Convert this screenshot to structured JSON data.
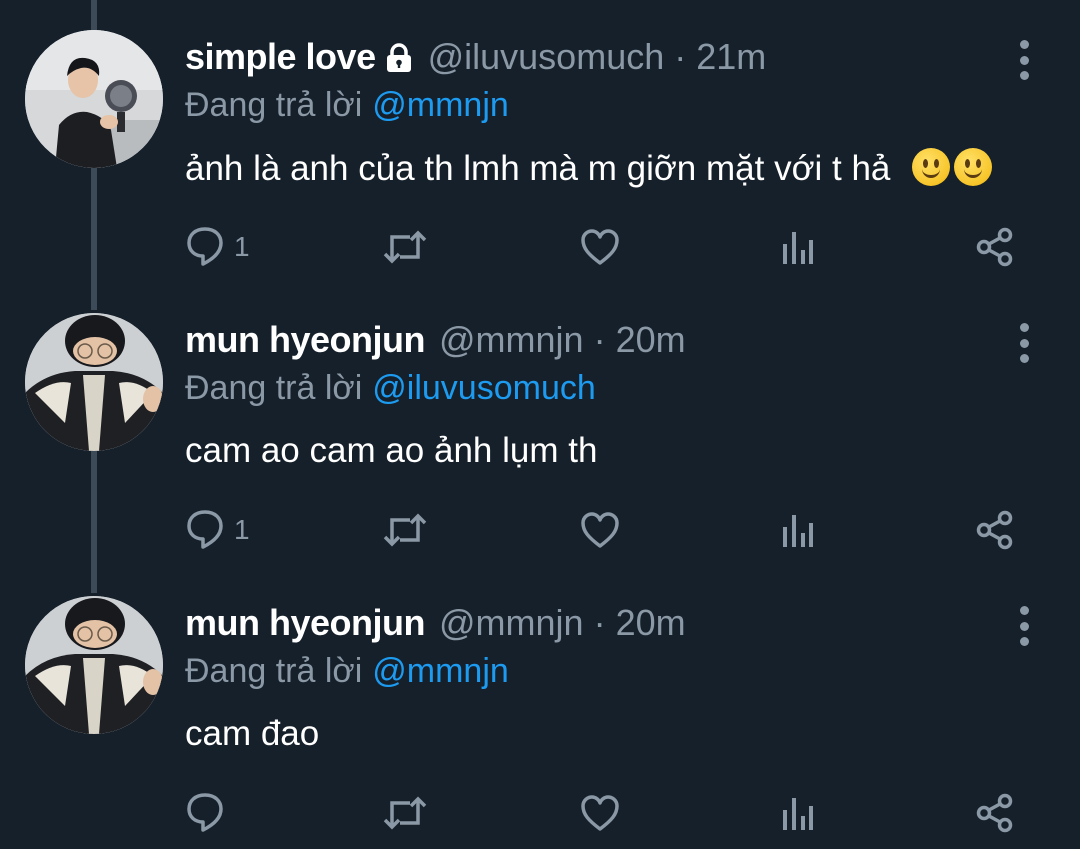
{
  "tweets": [
    {
      "name": "simple love",
      "locked": true,
      "handle": "@iluvusomuch",
      "time": "21m",
      "reply_prefix": "Đang trả lời",
      "reply_to": "@mmnjn",
      "text": "ảnh là anh của th lmh mà m giỡn mặt với t hả",
      "emojis": [
        "slightly-smiling-face",
        "slightly-smiling-face"
      ],
      "reply_count": "1"
    },
    {
      "name": "mun hyeonjun",
      "locked": false,
      "handle": "@mmnjn",
      "time": "20m",
      "reply_prefix": "Đang trả lời",
      "reply_to": "@iluvusomuch",
      "text": "cam ao cam ao ảnh lụm th",
      "emojis": [],
      "reply_count": "1"
    },
    {
      "name": "mun hyeonjun",
      "locked": false,
      "handle": "@mmnjn",
      "time": "20m",
      "reply_prefix": "Đang trả lời",
      "reply_to": "@mmnjn",
      "text": "cam đao",
      "emojis": [],
      "reply_count": ""
    }
  ],
  "separator": "·",
  "icons": [
    "reply-icon",
    "retweet-icon",
    "like-icon",
    "analytics-icon",
    "share-icon",
    "more-options-icon",
    "lock-icon"
  ],
  "colors": {
    "background": "#15202b",
    "primary_text": "#ffffff",
    "secondary_text": "#8b98a5",
    "mention": "#1d9bf0",
    "thread_line": "#3d4b59"
  }
}
